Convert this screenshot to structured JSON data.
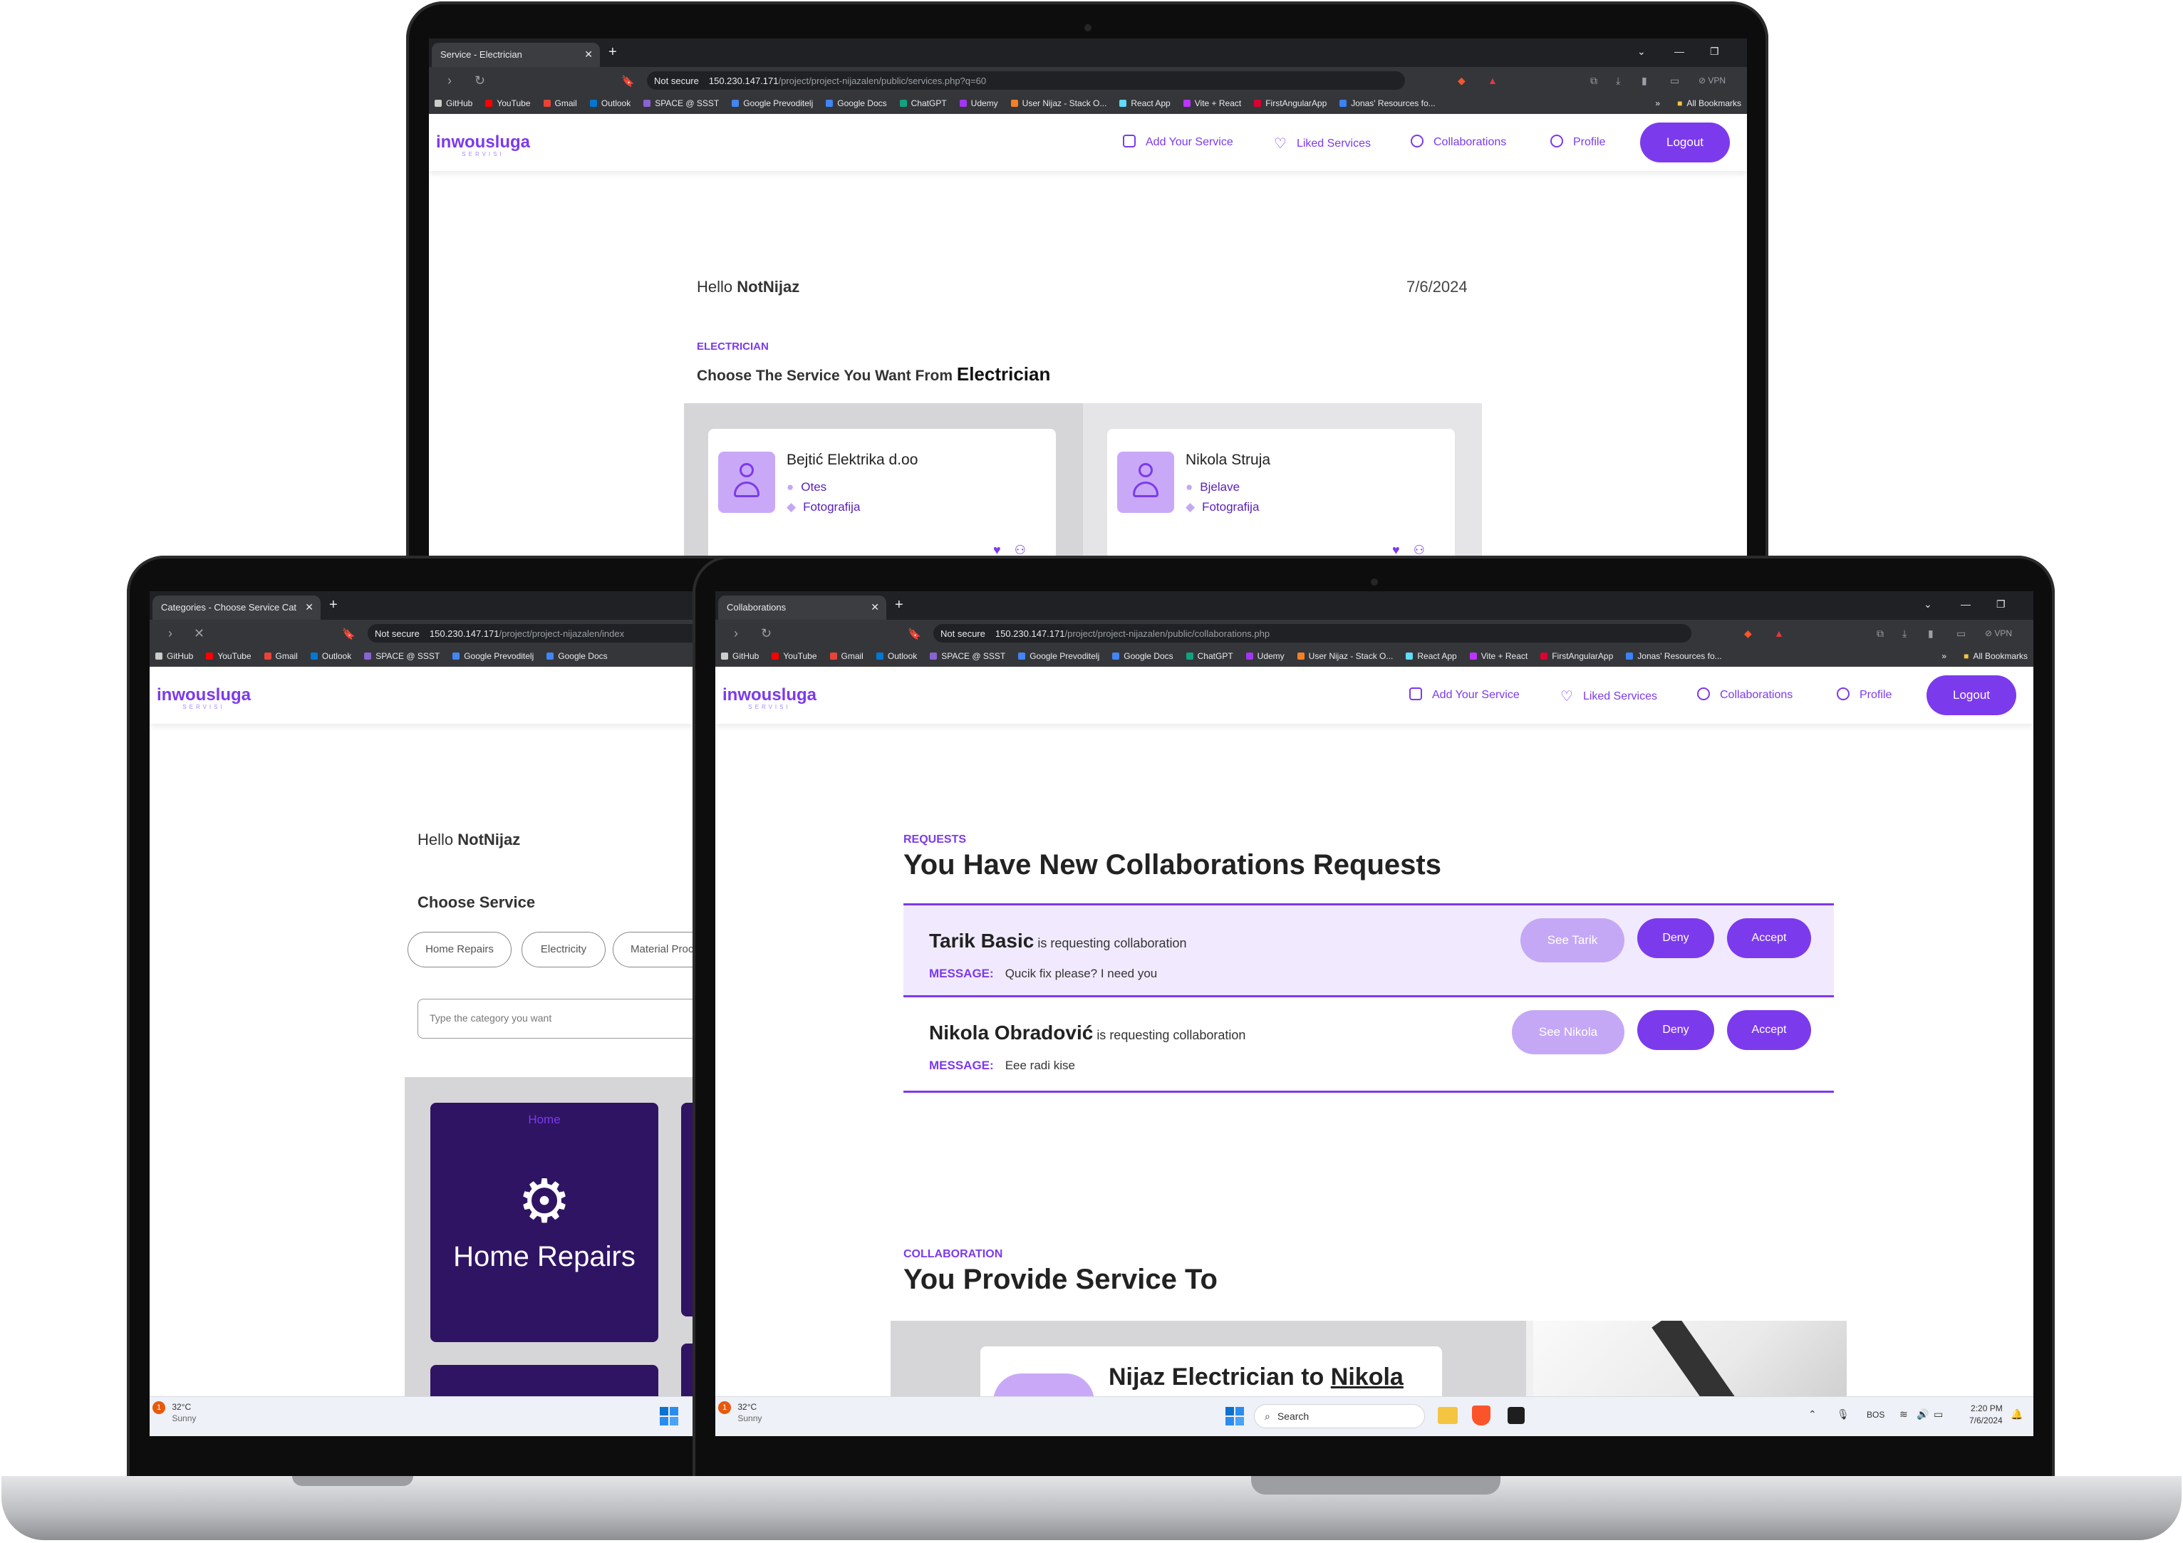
{
  "top_window": {
    "tab_title": "Service - Electrician",
    "url_security": "Not secure",
    "url_host": "150.230.147.171",
    "url_path": "/project/project-nijazalen/public/services.php?q=60",
    "greeting_prefix": "Hello",
    "username": "NotNijaz",
    "date": "7/6/2024",
    "eyebrow": "ELECTRICIAN",
    "heading_prefix": "Choose The Service You Want From",
    "heading_strong": "Electrician",
    "cards": [
      {
        "name": "Bejtić Elektrika d.oo",
        "location": "Otes",
        "category": "Fotografija"
      },
      {
        "name": "Nikola Struja",
        "location": "Bjelave",
        "category": "Fotografija"
      }
    ]
  },
  "left_window": {
    "tab_title": "Categories - Choose Service Cat",
    "url_security": "Not secure",
    "url_host": "150.230.147.171",
    "url_path": "/project/project-nijazalen/index",
    "greeting_prefix": "Hello",
    "username": "NotNijaz",
    "choose_heading": "Choose Service",
    "chips": [
      "Home Repairs",
      "Electricity",
      "Material Proc"
    ],
    "search_placeholder": "Type the category you want",
    "tile_caption": "Home",
    "tile_title": "Home Repairs",
    "weather_temp": "32°C",
    "weather_desc": "Sunny"
  },
  "right_window": {
    "tab_title": "Collaborations",
    "url_security": "Not secure",
    "url_host": "150.230.147.171",
    "url_path": "/project/project-nijazalen/public/collaborations.php",
    "requests_eyebrow": "REQUESTS",
    "requests_heading": "You Have New Collaborations Requests",
    "requests": [
      {
        "name": "Tarik Basic",
        "suffix": "is requesting collaboration",
        "message_label": "MESSAGE:",
        "message": "Qucik fix please? I need you",
        "see_label": "See Tarik",
        "deny_label": "Deny",
        "accept_label": "Accept"
      },
      {
        "name": "Nikola Obradović",
        "suffix": "is requesting collaboration",
        "message_label": "MESSAGE:",
        "message": "Eee radi kise",
        "see_label": "See Nikola",
        "deny_label": "Deny",
        "accept_label": "Accept"
      }
    ],
    "collab_eyebrow": "COLLABORATION",
    "collab_heading": "You Provide Service To",
    "collab_card_prefix": "Nijaz Electrician to",
    "collab_card_name": "Nikola",
    "weather_temp": "32°C",
    "weather_desc": "Sunny",
    "search_label": "Search",
    "lang": "BOS",
    "time": "2:20 PM",
    "date": "7/6/2024"
  },
  "site": {
    "logo": "inwousluga",
    "logo_sub": "SERVISI",
    "nav": {
      "add_service": "Add Your Service",
      "liked": "Liked Services",
      "collaborations": "Collaborations",
      "profile": "Profile",
      "logout": "Logout"
    }
  },
  "bookmarks": [
    "GitHub",
    "YouTube",
    "Gmail",
    "Outlook",
    "SPACE @ SSST",
    "Google Prevoditelj",
    "Google Docs",
    "ChatGPT",
    "Udemy",
    "User Nijaz - Stack O...",
    "React App",
    "Vite + React",
    "FirstAngularApp",
    "Jonas' Resources fo..."
  ],
  "bookmarks_left": [
    "GitHub",
    "YouTube",
    "Gmail",
    "Outlook",
    "SPACE @ SSST",
    "Google Prevoditelj",
    "Google Docs"
  ],
  "all_bookmarks": "All Bookmarks",
  "vpn": "VPN",
  "colors": {
    "accent": "#7c3aed",
    "accent_light": "#c4a8f5",
    "dark_purple": "#2f1464"
  }
}
